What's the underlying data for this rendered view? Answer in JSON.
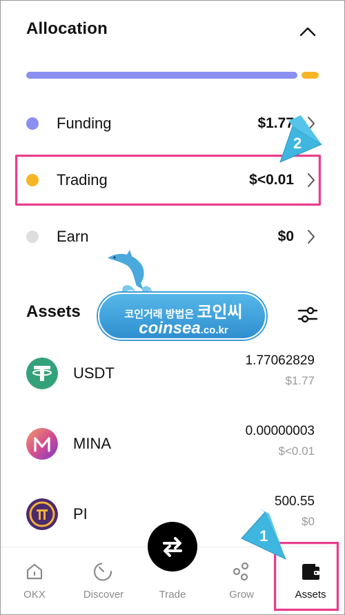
{
  "allocation": {
    "title": "Allocation",
    "bar": [
      {
        "name": "Funding",
        "fraction": 0.94,
        "color": "#8b8ff0"
      },
      {
        "name": "Trading",
        "fraction": 0.06,
        "color": "#f7b526"
      }
    ],
    "rows": [
      {
        "label": "Funding",
        "value": "$1.77",
        "color": "#8b8ff0"
      },
      {
        "label": "Trading",
        "value": "$<0.01",
        "color": "#f7b526"
      },
      {
        "label": "Earn",
        "value": "$0",
        "color": "#dedede"
      }
    ]
  },
  "assets": {
    "title": "Assets",
    "items": [
      {
        "symbol": "USDT",
        "quantity": "1.77062829",
        "usd": "$1.77",
        "icon": "tether-icon"
      },
      {
        "symbol": "MINA",
        "quantity": "0.00000003",
        "usd": "$<0.01",
        "icon": "mina-icon"
      },
      {
        "symbol": "PI",
        "quantity": "500.55",
        "usd": "$0",
        "icon": "pi-icon"
      }
    ]
  },
  "watermark": {
    "line1_small": "코인거래 방법은",
    "line1_big": "코인씨",
    "line2_main": "coinsea",
    "line2_small": ".co.kr"
  },
  "callouts": {
    "first": "1",
    "second": "2"
  },
  "nav": {
    "items": [
      {
        "label": "OKX",
        "icon": "home-icon"
      },
      {
        "label": "Discover",
        "icon": "discover-icon"
      },
      {
        "label": "Trade",
        "icon": "swap-icon"
      },
      {
        "label": "Grow",
        "icon": "grow-icon"
      },
      {
        "label": "Assets",
        "icon": "wallet-icon"
      }
    ],
    "active": "Assets"
  },
  "colors": {
    "highlight": "#e83e8c",
    "callout": "#3fb6e0"
  }
}
